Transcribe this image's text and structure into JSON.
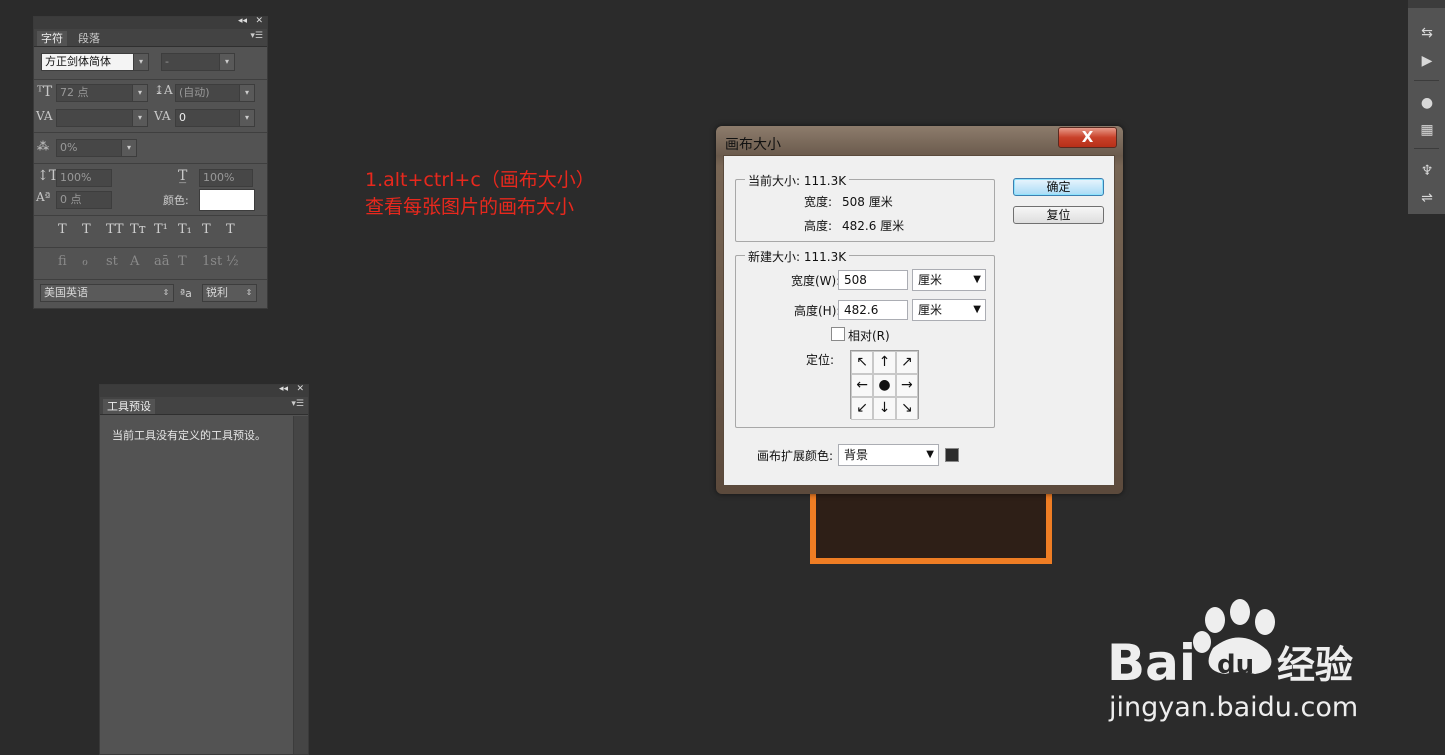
{
  "character_panel": {
    "tab_character": "字符",
    "tab_paragraph": "段落",
    "font_family": "方正剑体简体",
    "font_style": "-",
    "font_size": "72 点",
    "leading": "(自动)",
    "kerning": "",
    "tracking": "0",
    "tsume": "0%",
    "vertical_scale": "100%",
    "horizontal_scale": "100%",
    "baseline_shift": "0 点",
    "color_label": "颜色:",
    "color_value": "#ffffff",
    "style_buttons": [
      "T",
      "T",
      "TT",
      "Tт",
      "T¹",
      "T₁",
      "T",
      "T"
    ],
    "opentype_buttons": [
      "fi",
      "ℴ",
      "st",
      "A",
      "aā",
      "T",
      "1st",
      "½"
    ],
    "language": "美国英语",
    "aa_icon_label": "ªa",
    "antialias": "锐利"
  },
  "preset_panel": {
    "tab_label": "工具预设",
    "message": "当前工具没有定义的工具预设。"
  },
  "annotation": {
    "line1": "1.alt+ctrl+c（画布大小）",
    "line2": "查看每张图片的画布大小"
  },
  "dialog": {
    "title": "画布大小",
    "close_label": "X",
    "current_size_legend": "当前大小: 111.3K",
    "current_width_label": "宽度:",
    "current_width_value": "508 厘米",
    "current_height_label": "高度:",
    "current_height_value": "482.6 厘米",
    "new_size_legend": "新建大小: 111.3K",
    "width_label": "宽度(W):",
    "width_value": "508",
    "width_unit": "厘米",
    "height_label": "高度(H):",
    "height_value": "482.6",
    "height_unit": "厘米",
    "relative_label": "相对(R)",
    "relative_checked": false,
    "anchor_label": "定位:",
    "anchor_arrows": [
      "↖",
      "↑",
      "↗",
      "←",
      "●",
      "→",
      "↙",
      "↓",
      "↘"
    ],
    "extension_label": "画布扩展颜色:",
    "extension_value": "背景",
    "extension_swatch": "#2b2b2b",
    "ok_label": "确定",
    "reset_label": "复位"
  },
  "watermark": {
    "brand": "Bai",
    "brand_suffix": "du",
    "brand_cn": "经验",
    "url": "jingyan.baidu.com"
  },
  "colors": {
    "annotation": "#e8281d",
    "doc_border": "#ef7d24",
    "workspace": "#2b2b2b"
  }
}
